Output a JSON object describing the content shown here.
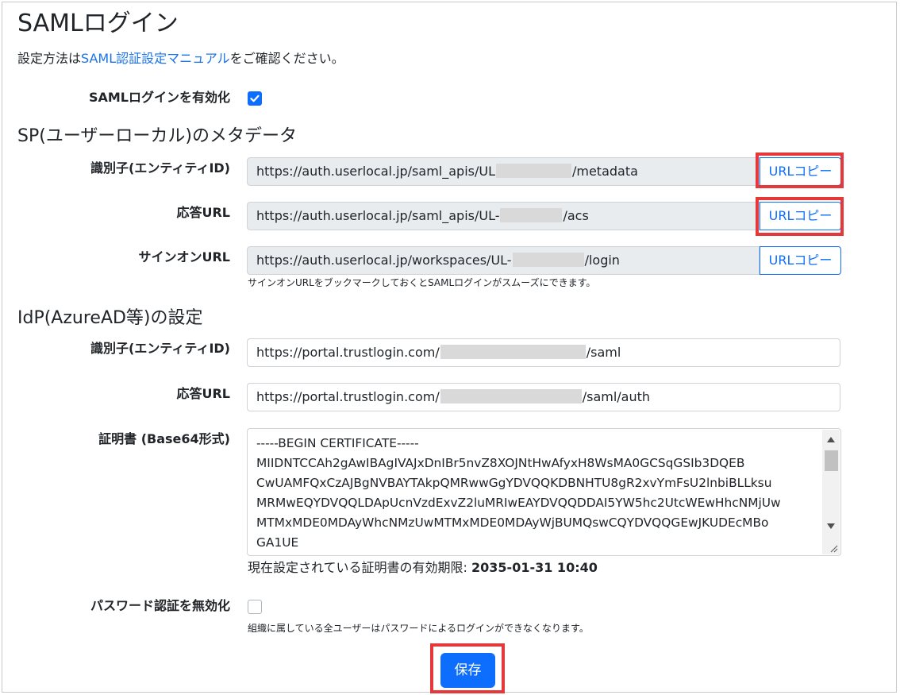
{
  "page": {
    "title": "SAMLログイン",
    "note_prefix": "設定方法は",
    "note_link": "SAML認証設定マニュアル",
    "note_suffix": "をご確認ください。"
  },
  "enable_saml": {
    "label": "SAMLログインを有効化",
    "checked": true
  },
  "sp_section": {
    "title": "SP(ユーザーローカル)のメタデータ",
    "entity_id": {
      "label": "識別子(エンティティID)",
      "prefix": "https://auth.userlocal.jp/saml_apis/UL",
      "suffix": "/metadata",
      "copy_label": "URLコピー"
    },
    "acs_url": {
      "label": "応答URL",
      "prefix": "https://auth.userlocal.jp/saml_apis/UL-",
      "suffix": "/acs",
      "copy_label": "URLコピー"
    },
    "signon_url": {
      "label": "サインオンURL",
      "prefix": "https://auth.userlocal.jp/workspaces/UL-",
      "suffix": "/login",
      "copy_label": "URLコピー",
      "help": "サインオンURLをブックマークしておくとSAMLログインがスムーズにできます。"
    }
  },
  "idp_section": {
    "title": "IdP(AzureAD等)の設定",
    "entity_id": {
      "label": "識別子(エンティティID)",
      "prefix": "https://portal.trustlogin.com/",
      "suffix": "/saml"
    },
    "reply_url": {
      "label": "応答URL",
      "prefix": "https://portal.trustlogin.com/",
      "suffix": "/saml/auth"
    },
    "certificate": {
      "label": "証明書 (Base64形式)",
      "lines": [
        "-----BEGIN CERTIFICATE-----",
        "MIIDNTCCAh2gAwIBAgIVAJxDnIBr5nvZ8XOJNtHwAfyxH8WsMA0GCSqGSIb3DQEB",
        "CwUAMFQxCzAJBgNVBAYTAkpQMRwwGgYDVQQKDBNHTU8gR2xvYmFsU2lnbiBLLksu",
        "MRMwEQYDVQQLDApUcnVzdExvZ2luMRIwEAYDVQQDDAI5YW5hc2UtcWEwHhcNMjUw",
        "MTMxMDE0MDAyWhcNMzUwMTMxMDE0MDAyWjBUMQswCQYDVQQGEwJKUDEcMBo",
        "GA1UE"
      ],
      "validity_label": "現在設定されている証明書の有効期限:",
      "validity_value": "2035-01-31 10:40"
    }
  },
  "disable_password": {
    "label": "パスワード認証を無効化",
    "checked": false,
    "help": "組織に属している全ユーザーはパスワードによるログインができなくなります。"
  },
  "save_label": "保存"
}
